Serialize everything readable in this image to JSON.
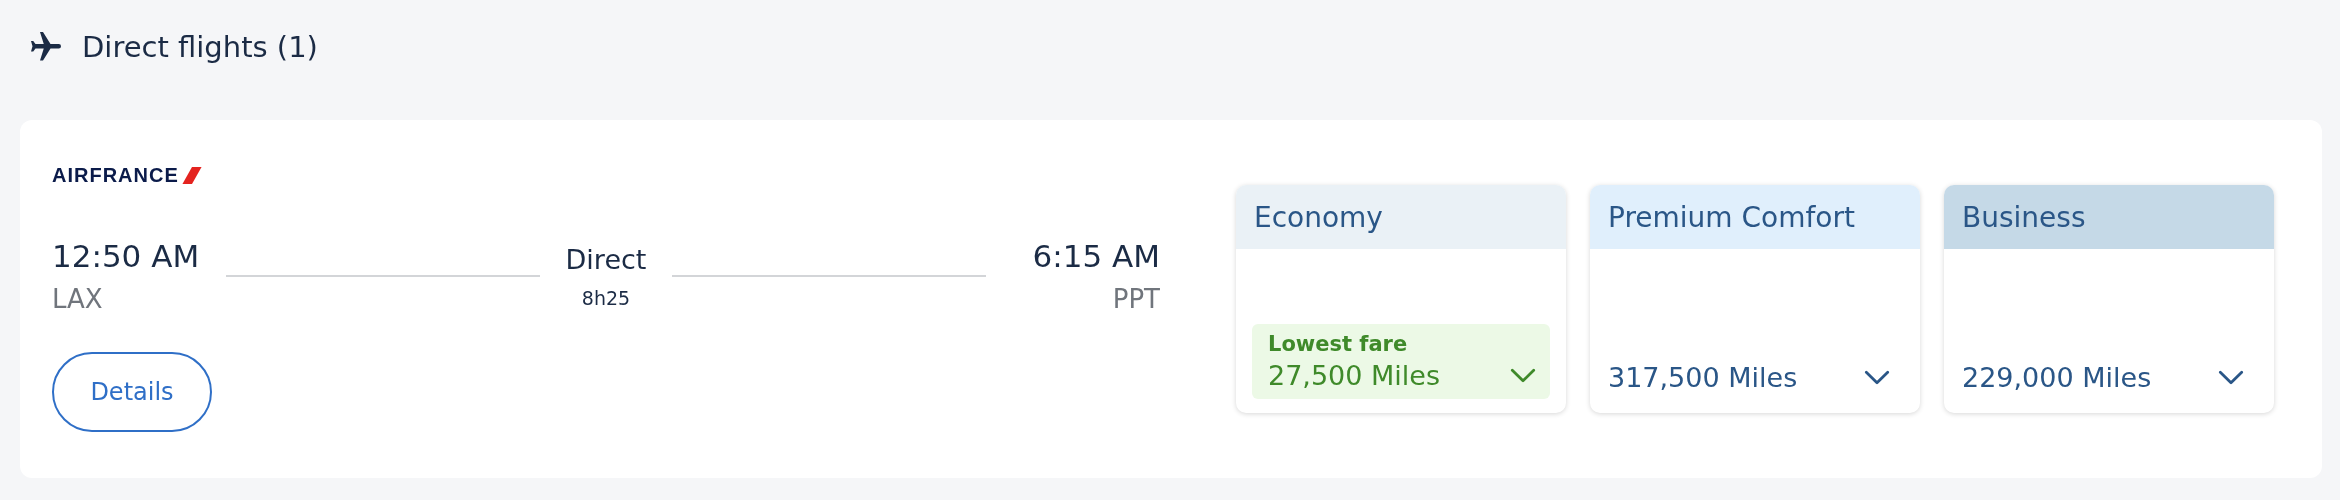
{
  "section": {
    "title": "Direct flights (1)"
  },
  "flight": {
    "airline": "AIRFRANCE",
    "departure": {
      "time": "12:50 AM",
      "airport": "LAX"
    },
    "stops": "Direct",
    "duration": "8h25",
    "arrival": {
      "time": "6:15 AM",
      "airport": "PPT"
    },
    "details_button": "Details"
  },
  "fares": [
    {
      "cabin": "Economy",
      "color": "#eaf1f6",
      "kind": "lowest",
      "badge": "Lowest fare",
      "price": "27,500 Miles"
    },
    {
      "cabin": "Premium Comfort",
      "color": "#e0effc",
      "kind": "standard",
      "price": "317,500 Miles"
    },
    {
      "cabin": "Business",
      "color": "#c5d9e7",
      "kind": "standard",
      "price": "229,000 Miles"
    }
  ]
}
